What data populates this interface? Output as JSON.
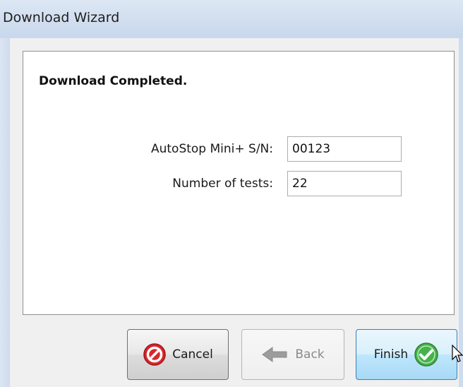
{
  "window": {
    "title": "Download Wizard"
  },
  "panel": {
    "heading": "Download Completed.",
    "fields": [
      {
        "label": "AutoStop Mini+ S/N:",
        "value": "00123"
      },
      {
        "label": "Number of tests:",
        "value": "22"
      }
    ]
  },
  "buttons": {
    "cancel": {
      "label": "Cancel",
      "icon": "cancel-icon"
    },
    "back": {
      "label": "Back",
      "icon": "back-arrow-icon",
      "enabled": false
    },
    "finish": {
      "label": "Finish",
      "icon": "checkmark-icon"
    }
  },
  "colors": {
    "titlebar": "#c8d7ec",
    "cancel_icon": "#d8262a",
    "finish_icon": "#44b34a",
    "finish_button": "#bee6fd"
  }
}
